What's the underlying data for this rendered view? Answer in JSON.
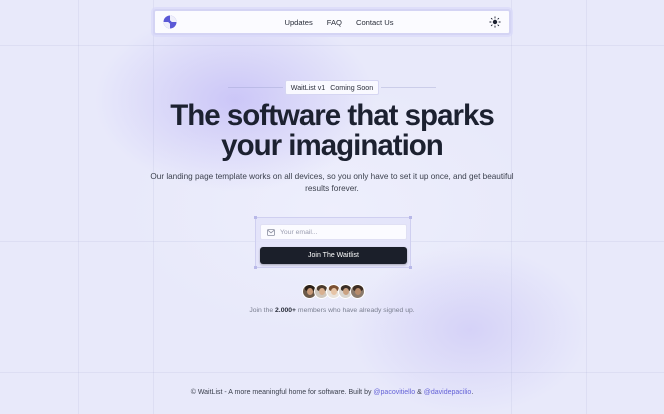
{
  "nav": {
    "links": [
      "Updates",
      "FAQ",
      "Contact Us"
    ],
    "logo_icon": "brand-logo-icon",
    "theme_icon": "sun-icon"
  },
  "badge": {
    "name": "WaitList v1",
    "status": "Coming Soon"
  },
  "hero": {
    "headline_line1": "The software that sparks",
    "headline_line2": "your imagination",
    "subtitle": "Our landing page template works on all devices, so you only have to set it up once, and get beautiful results forever."
  },
  "form": {
    "email_placeholder": "Your email...",
    "email_icon": "mail-icon",
    "button_label": "Join The Waitlist"
  },
  "social_proof": {
    "prefix": "Join the",
    "count": "2.000+",
    "suffix": "members who have already signed up.",
    "avatar_count": 5
  },
  "footer": {
    "text": "© WaitList - A more meaningful home for software. Built by",
    "author1": "@pacovitiello",
    "joiner": "&",
    "author2": "@davidepacilio",
    "end": "."
  },
  "colors": {
    "background": "#e8e9fa",
    "accent": "#6563d8",
    "button": "#1b1f2a",
    "heading": "#1c2130"
  }
}
